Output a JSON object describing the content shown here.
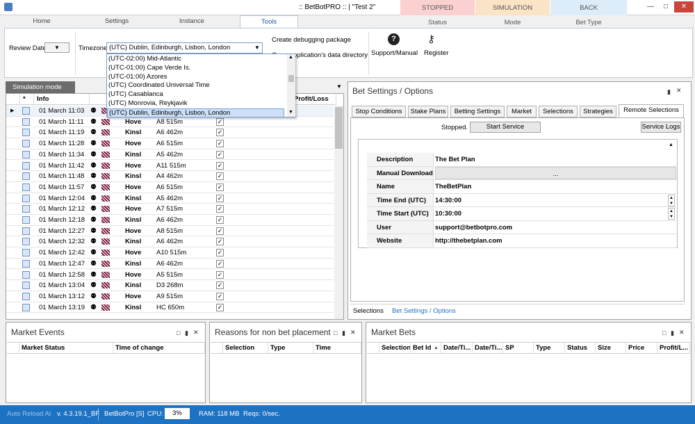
{
  "window": {
    "title": ":: BetBotPRO :: | \"Test 2\""
  },
  "status": [
    {
      "top": "STOPPED",
      "bottom": "Status",
      "color": "#fbd0d0"
    },
    {
      "top": "SIMULATION",
      "bottom": "Mode",
      "color": "#fbe3c6"
    },
    {
      "top": "BACK",
      "bottom": "Bet Type",
      "color": "#dcecf8"
    }
  ],
  "tabs": [
    "Home",
    "Settings",
    "Instance",
    "Tools"
  ],
  "ribbon": {
    "review_date": "Review Date",
    "timezone_label": "Timezone",
    "timezone_value": "(UTC) Dublin, Edinburgh, Lisbon, London",
    "create_debug": "Create debugging package",
    "open_data_dir": "Open application's data directory",
    "support": "Support/Manual",
    "register": "Register"
  },
  "timezone_options": [
    "(UTC-02:00) Mid-Atlantic",
    "(UTC-01:00) Cape Verde Is.",
    "(UTC-01:00) Azores",
    "(UTC) Coordinated Universal Time",
    "(UTC) Casablanca",
    "(UTC) Monrovia, Reykjavik",
    "(UTC) Dublin, Edinburgh, Lisbon, London"
  ],
  "sim_tab": "Simulation mode",
  "grid": {
    "headers": [
      "*",
      "Info",
      "Profit/Loss"
    ],
    "rows": [
      {
        "time": "01 March 11:03",
        "venue": "",
        "race": "",
        "sel": false
      },
      {
        "time": "01 March 11:11",
        "venue": "Hove",
        "race": "A8 515m",
        "sel": true
      },
      {
        "time": "01 March 11:19",
        "venue": "Kinsl",
        "race": "A6 462m",
        "sel": true
      },
      {
        "time": "01 March 11:28",
        "venue": "Hove",
        "race": "A6 515m",
        "sel": true
      },
      {
        "time": "01 March 11:34",
        "venue": "Kinsl",
        "race": "A5 462m",
        "sel": true
      },
      {
        "time": "01 March 11:42",
        "venue": "Hove",
        "race": "A11 515m",
        "sel": true
      },
      {
        "time": "01 March 11:48",
        "venue": "Kinsl",
        "race": "A4 462m",
        "sel": true
      },
      {
        "time": "01 March 11:57",
        "venue": "Hove",
        "race": "A6 515m",
        "sel": true
      },
      {
        "time": "01 March 12:04",
        "venue": "Kinsl",
        "race": "A5 462m",
        "sel": true
      },
      {
        "time": "01 March 12:12",
        "venue": "Hove",
        "race": "A7 515m",
        "sel": true
      },
      {
        "time": "01 March 12:18",
        "venue": "Kinsl",
        "race": "A6 462m",
        "sel": true
      },
      {
        "time": "01 March 12:27",
        "venue": "Hove",
        "race": "A8 515m",
        "sel": true
      },
      {
        "time": "01 March 12:32",
        "venue": "Kinsl",
        "race": "A6 462m",
        "sel": true
      },
      {
        "time": "01 March 12:42",
        "venue": "Hove",
        "race": "A10 515m",
        "sel": true
      },
      {
        "time": "01 March 12:47",
        "venue": "Kinsl",
        "race": "A6 462m",
        "sel": true
      },
      {
        "time": "01 March 12:58",
        "venue": "Hove",
        "race": "A5 515m",
        "sel": true
      },
      {
        "time": "01 March 13:04",
        "venue": "Kinsl",
        "race": "D3 268m",
        "sel": true
      },
      {
        "time": "01 March 13:12",
        "venue": "Hove",
        "race": "A9 515m",
        "sel": true
      },
      {
        "time": "01 March 13:19",
        "venue": "Kinsl",
        "race": "HC 650m",
        "sel": true
      }
    ]
  },
  "bet_settings": {
    "title": "Bet Settings / Options",
    "subtabs": [
      "Stop Conditions",
      "Stake Plans",
      "Betting Settings",
      "Market",
      "Selections",
      "Strategies",
      "Remote Selections"
    ],
    "stopped": "Stopped.",
    "start_service": "Start Service",
    "service_logs": "Service Logs",
    "props": [
      {
        "k": "Description",
        "v": "The Bet Plan"
      },
      {
        "k": "Manual Download",
        "v": "..."
      },
      {
        "k": "Name",
        "v": "TheBetPlan"
      },
      {
        "k": "Time End (UTC)",
        "v": "14:30:00"
      },
      {
        "k": "Time Start (UTC)",
        "v": "10:30:00"
      },
      {
        "k": "User Identification",
        "v": "support@betbotpro.com"
      },
      {
        "k": "Website",
        "v": "http://thebetplan.com"
      }
    ],
    "bottom_tabs": [
      "Selections",
      "Bet Settings / Options"
    ]
  },
  "market_events": {
    "title": "Market Events",
    "cols": [
      "Market Status",
      "Time of change"
    ]
  },
  "reasons": {
    "title": "Reasons for non bet placement",
    "cols": [
      "Selection",
      "Type",
      "Time"
    ]
  },
  "market_bets": {
    "title": "Market Bets",
    "cols": [
      "Selection",
      "Bet Id",
      "Date/Ti...",
      "Date/Ti...",
      "SP",
      "Type",
      "Status",
      "Size",
      "Price",
      "Profit/L..."
    ]
  },
  "statusbar": {
    "auto": "Auto Reload At",
    "version": "v. 4.3.19.1_BF",
    "instance": "BetBotPro [S]",
    "cpu_label": "CPU:",
    "cpu": "3%",
    "ram": "RAM: 118 MB",
    "reqs": "Reqs: 0/sec."
  }
}
